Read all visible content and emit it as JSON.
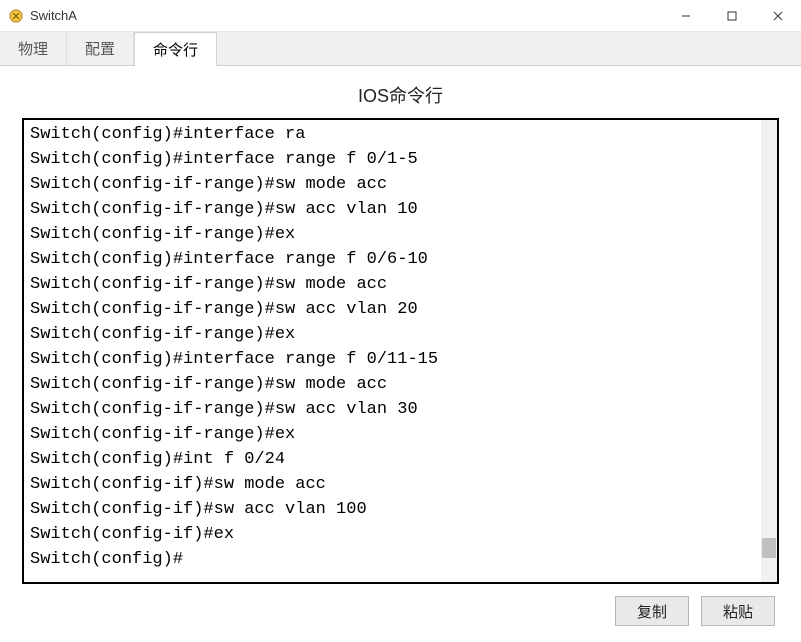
{
  "window": {
    "title": "SwitchA"
  },
  "tabs": [
    {
      "label": "物理",
      "active": false
    },
    {
      "label": "配置",
      "active": false
    },
    {
      "label": "命令行",
      "active": true
    }
  ],
  "section_title": "IOS命令行",
  "terminal_lines": [
    "Switch(config)#interface ra",
    "Switch(config)#interface range f 0/1-5",
    "Switch(config-if-range)#sw mode acc",
    "Switch(config-if-range)#sw acc vlan 10",
    "Switch(config-if-range)#ex",
    "Switch(config)#interface range f 0/6-10",
    "Switch(config-if-range)#sw mode acc",
    "Switch(config-if-range)#sw acc vlan 20",
    "Switch(config-if-range)#ex",
    "Switch(config)#interface range f 0/11-15",
    "Switch(config-if-range)#sw mode acc",
    "Switch(config-if-range)#sw acc vlan 30",
    "Switch(config-if-range)#ex",
    "Switch(config)#int f 0/24",
    "Switch(config-if)#sw mode acc",
    "Switch(config-if)#sw acc vlan 100",
    "Switch(config-if)#ex",
    "Switch(config)#"
  ],
  "buttons": {
    "copy": "复制",
    "paste": "粘贴"
  }
}
